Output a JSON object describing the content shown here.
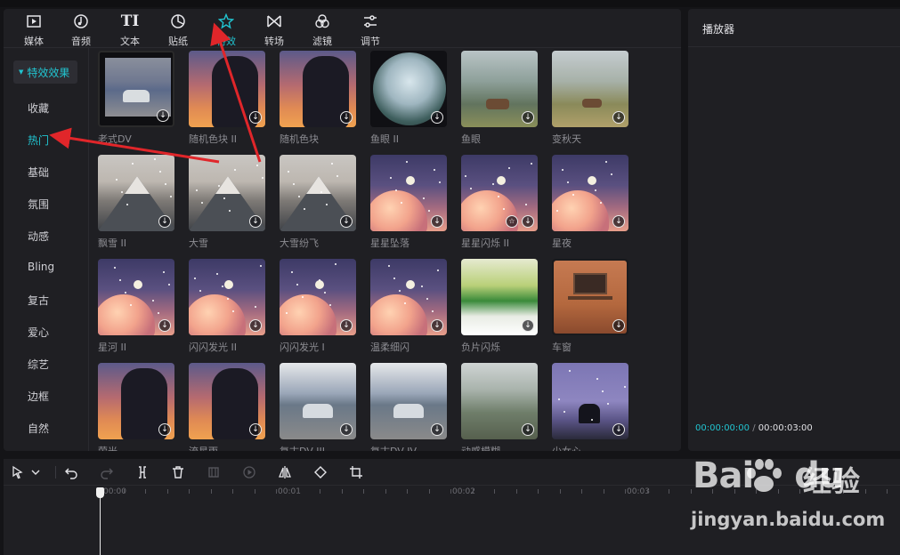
{
  "tabs": [
    {
      "label": "媒体",
      "icon": "media-icon"
    },
    {
      "label": "音频",
      "icon": "audio-icon"
    },
    {
      "label": "文本",
      "icon": "text-icon"
    },
    {
      "label": "贴纸",
      "icon": "sticker-icon"
    },
    {
      "label": "特效",
      "icon": "effects-icon",
      "active": true
    },
    {
      "label": "转场",
      "icon": "transition-icon"
    },
    {
      "label": "滤镜",
      "icon": "filter-icon"
    },
    {
      "label": "调节",
      "icon": "adjust-icon"
    }
  ],
  "sidebar": {
    "header": "特效效果",
    "items": [
      "收藏",
      "热门",
      "基础",
      "氛围",
      "动感",
      "Bling",
      "复古",
      "爱心",
      "综艺",
      "边框",
      "自然"
    ],
    "active_index": 1
  },
  "effects": [
    {
      "name": "老式DV"
    },
    {
      "name": "随机色块 II"
    },
    {
      "name": "随机色块"
    },
    {
      "name": "鱼眼 II"
    },
    {
      "name": "鱼眼"
    },
    {
      "name": "变秋天"
    },
    {
      "name": "飘雪 II"
    },
    {
      "name": "大雪"
    },
    {
      "name": "大雪纷飞"
    },
    {
      "name": "星星坠落"
    },
    {
      "name": "星星闪烁 II"
    },
    {
      "name": "星夜"
    },
    {
      "name": "星河 II"
    },
    {
      "name": "闪闪发光 II"
    },
    {
      "name": "闪闪发光 I"
    },
    {
      "name": "温柔细闪"
    },
    {
      "name": "负片闪烁"
    },
    {
      "name": "车窗"
    },
    {
      "name": "萤光"
    },
    {
      "name": "流星雨"
    },
    {
      "name": "复古DV III"
    },
    {
      "name": "复古DV IV"
    },
    {
      "name": "动感模糊"
    },
    {
      "name": "少女心"
    }
  ],
  "player": {
    "title": "播放器",
    "current_time": "00:00:00:00",
    "separator": "/",
    "total_time": "00:00:03:00"
  },
  "timeline": {
    "ruler_labels": [
      "00:00",
      "00:01",
      "00:02",
      "00:03"
    ]
  },
  "watermark": {
    "logo": "Bai",
    "logo_suffix": "du",
    "text": "经验",
    "url": "jingyan.baidu.com"
  },
  "colors": {
    "accent": "#21c4d0",
    "panel": "#1f1f23",
    "background": "#141417",
    "annotation_arrow": "#e0262a"
  }
}
